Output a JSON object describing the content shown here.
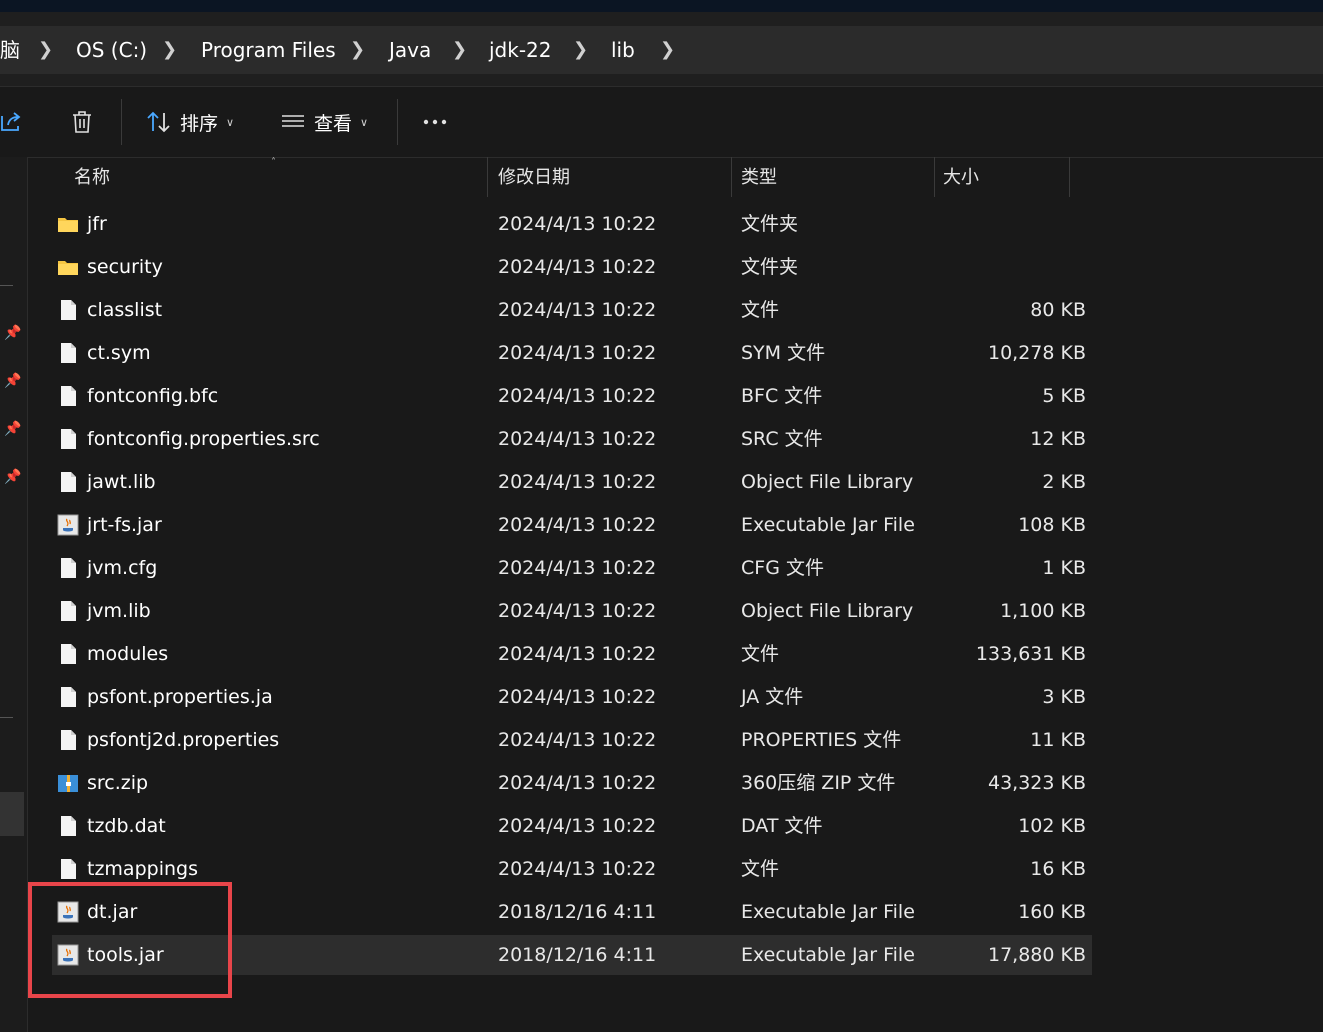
{
  "breadcrumb": {
    "items": [
      "脑",
      "OS (C:)",
      "Program Files",
      "Java",
      "jdk-22",
      "lib"
    ]
  },
  "toolbar": {
    "sort_label": "排序",
    "view_label": "查看",
    "more_label": "..."
  },
  "columns": {
    "name": "名称",
    "date": "修改日期",
    "type": "类型",
    "size": "大小"
  },
  "files": [
    {
      "name": "jfr",
      "date": "2024/4/13 10:22",
      "type": "文件夹",
      "size": "",
      "icon": "folder-icon"
    },
    {
      "name": "security",
      "date": "2024/4/13 10:22",
      "type": "文件夹",
      "size": "",
      "icon": "folder-icon"
    },
    {
      "name": "classlist",
      "date": "2024/4/13 10:22",
      "type": "文件",
      "size": "80 KB",
      "icon": "file-icon"
    },
    {
      "name": "ct.sym",
      "date": "2024/4/13 10:22",
      "type": "SYM 文件",
      "size": "10,278 KB",
      "icon": "file-icon"
    },
    {
      "name": "fontconfig.bfc",
      "date": "2024/4/13 10:22",
      "type": "BFC 文件",
      "size": "5 KB",
      "icon": "file-icon"
    },
    {
      "name": "fontconfig.properties.src",
      "date": "2024/4/13 10:22",
      "type": "SRC 文件",
      "size": "12 KB",
      "icon": "file-icon"
    },
    {
      "name": "jawt.lib",
      "date": "2024/4/13 10:22",
      "type": "Object File Library",
      "size": "2 KB",
      "icon": "file-icon"
    },
    {
      "name": "jrt-fs.jar",
      "date": "2024/4/13 10:22",
      "type": "Executable Jar File",
      "size": "108 KB",
      "icon": "jar-icon"
    },
    {
      "name": "jvm.cfg",
      "date": "2024/4/13 10:22",
      "type": "CFG 文件",
      "size": "1 KB",
      "icon": "file-icon"
    },
    {
      "name": "jvm.lib",
      "date": "2024/4/13 10:22",
      "type": "Object File Library",
      "size": "1,100 KB",
      "icon": "file-icon"
    },
    {
      "name": "modules",
      "date": "2024/4/13 10:22",
      "type": "文件",
      "size": "133,631 KB",
      "icon": "file-icon"
    },
    {
      "name": "psfont.properties.ja",
      "date": "2024/4/13 10:22",
      "type": "JA 文件",
      "size": "3 KB",
      "icon": "file-icon"
    },
    {
      "name": "psfontj2d.properties",
      "date": "2024/4/13 10:22",
      "type": "PROPERTIES 文件",
      "size": "11 KB",
      "icon": "file-icon"
    },
    {
      "name": "src.zip",
      "date": "2024/4/13 10:22",
      "type": "360压缩 ZIP 文件",
      "size": "43,323 KB",
      "icon": "zip-icon"
    },
    {
      "name": "tzdb.dat",
      "date": "2024/4/13 10:22",
      "type": "DAT 文件",
      "size": "102 KB",
      "icon": "file-icon"
    },
    {
      "name": "tzmappings",
      "date": "2024/4/13 10:22",
      "type": "文件",
      "size": "16 KB",
      "icon": "file-icon"
    },
    {
      "name": "dt.jar",
      "date": "2018/12/16 4:11",
      "type": "Executable Jar File",
      "size": "160 KB",
      "icon": "jar-icon"
    },
    {
      "name": "tools.jar",
      "date": "2018/12/16 4:11",
      "type": "Executable Jar File",
      "size": "17,880 KB",
      "icon": "jar-icon",
      "selected": true
    }
  ],
  "colors": {
    "background": "#191919",
    "highlight_box": "#e8454a",
    "folder": "#f5c542"
  }
}
